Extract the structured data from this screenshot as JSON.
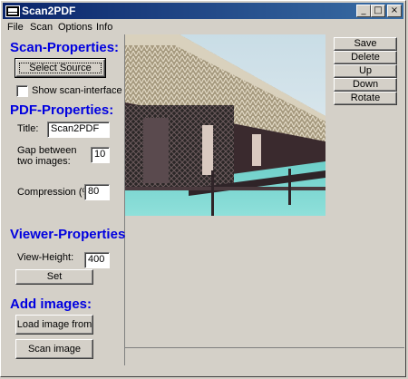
{
  "app": {
    "title": "Scan2PDF"
  },
  "titlebar": {
    "min_glyph": "_",
    "max_glyph": "□",
    "close_glyph": "×"
  },
  "menu": [
    "File",
    "Scan",
    "Options",
    "Info"
  ],
  "scan": {
    "heading": "Scan-Properties:",
    "select_source": "Select Source",
    "show_interface": "Show scan-interface",
    "show_interface_checked": false
  },
  "pdf": {
    "heading": "PDF-Properties:",
    "title_label": "Title:",
    "title_value": "Scan2PDF",
    "gap_label_1": "Gap between",
    "gap_label_2": "two images:",
    "gap_value": "10",
    "compression_label": "Compression (%):",
    "compression_value": "80"
  },
  "viewer": {
    "heading": "Viewer-Properties:",
    "height_label": "View-Height:",
    "height_value": "400",
    "set": "Set"
  },
  "add": {
    "heading": "Add images:",
    "load": "Load image from",
    "scan": "Scan image"
  },
  "actions": [
    "Save",
    "Delete",
    "Up",
    "Down",
    "Rotate"
  ],
  "colors": {
    "heading": "#0000e0",
    "titlebar": "#0a246a",
    "face": "#d4d0c8"
  }
}
